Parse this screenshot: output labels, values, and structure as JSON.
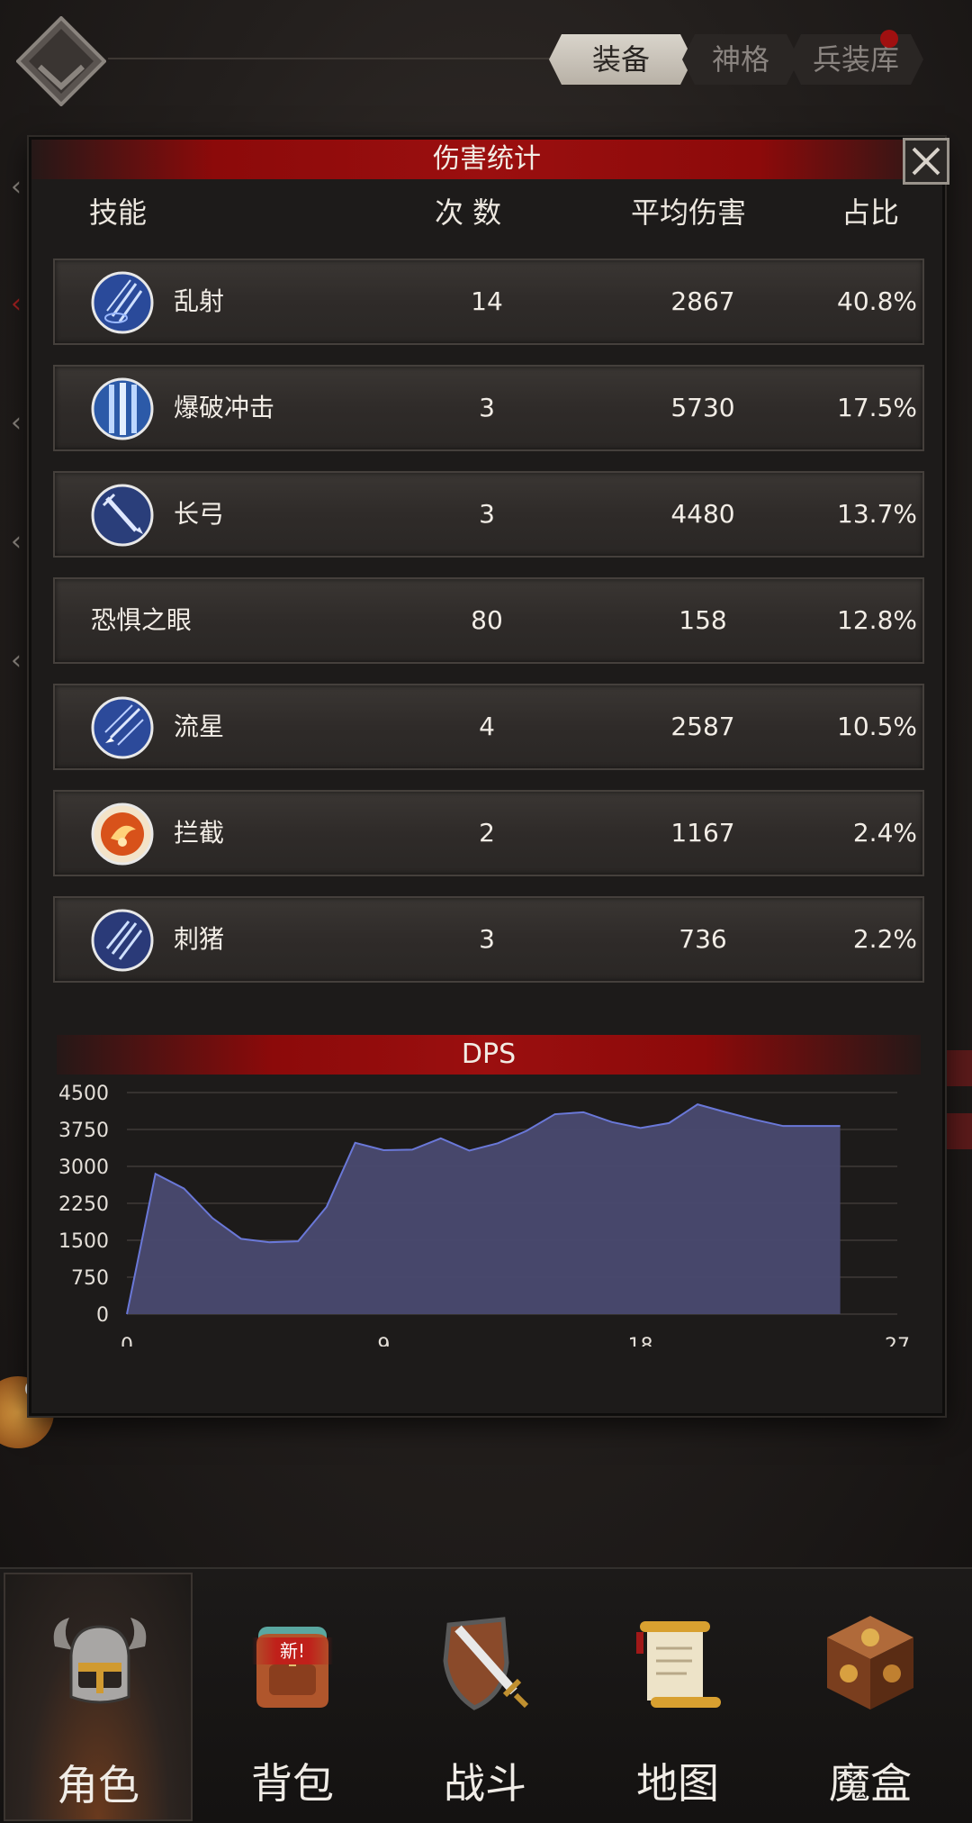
{
  "header": {
    "tabs": [
      {
        "label": "装备",
        "active": true
      },
      {
        "label": "神格",
        "active": false
      },
      {
        "label": "兵装库",
        "active": false
      }
    ]
  },
  "panel": {
    "title": "伤害统计",
    "columns": {
      "skill": "技能",
      "count": "次 数",
      "avg": "平均伤害",
      "pct": "占比"
    },
    "rows": [
      {
        "name": "乱射",
        "count": "14",
        "avg": "2867",
        "pct": "40.8%",
        "icon": "arrow-rain-icon"
      },
      {
        "name": "爆破冲击",
        "count": "3",
        "avg": "5730",
        "pct": "17.5%",
        "icon": "blast-impact-icon"
      },
      {
        "name": "长弓",
        "count": "3",
        "avg": "4480",
        "pct": "13.7%",
        "icon": "longbow-icon"
      },
      {
        "name": "恐惧之眼",
        "count": "80",
        "avg": "158",
        "pct": "12.8%",
        "icon": ""
      },
      {
        "name": "流星",
        "count": "4",
        "avg": "2587",
        "pct": "10.5%",
        "icon": "meteor-icon"
      },
      {
        "name": "拦截",
        "count": "2",
        "avg": "1167",
        "pct": "2.4%",
        "icon": "intercept-fire-icon"
      },
      {
        "name": "刺猪",
        "count": "3",
        "avg": "736",
        "pct": "2.2%",
        "icon": "spike-pig-icon"
      }
    ]
  },
  "chart_data": {
    "type": "area",
    "title": "DPS",
    "xlim": [
      0,
      27
    ],
    "ylim": [
      0,
      4500
    ],
    "x_ticks": [
      "0",
      "9",
      "18",
      "27"
    ],
    "y_ticks": [
      "0",
      "750",
      "1500",
      "2250",
      "3000",
      "3750",
      "4500"
    ],
    "grid": true,
    "fill_color": "#4a4a70",
    "line_color": "#6a78d8",
    "x": [
      0,
      1,
      2,
      3,
      4,
      5,
      6,
      7,
      8,
      9,
      10,
      11,
      12,
      13,
      14,
      15,
      16,
      17,
      18,
      19,
      20,
      21,
      22,
      23,
      24,
      25
    ],
    "y": [
      0,
      2850,
      2550,
      1950,
      1530,
      1460,
      1480,
      2180,
      3480,
      3330,
      3340,
      3570,
      3320,
      3470,
      3720,
      4060,
      4100,
      3900,
      3780,
      3880,
      4260,
      4100,
      3950,
      3820,
      3820,
      3820
    ]
  },
  "nav": {
    "items": [
      {
        "label": "角色",
        "icon": "horned-helmet-icon",
        "active": true
      },
      {
        "label": "背包",
        "icon": "backpack-icon",
        "active": false,
        "badge": "新!"
      },
      {
        "label": "战斗",
        "icon": "sword-shield-icon",
        "active": false
      },
      {
        "label": "地图",
        "icon": "map-scroll-icon",
        "active": false
      },
      {
        "label": "魔盒",
        "icon": "magic-box-icon",
        "active": false
      }
    ]
  },
  "colors": {
    "accent_red": "#9b0f0f",
    "row_bg": "#332f2c",
    "dps_fill": "#4a4a70"
  }
}
